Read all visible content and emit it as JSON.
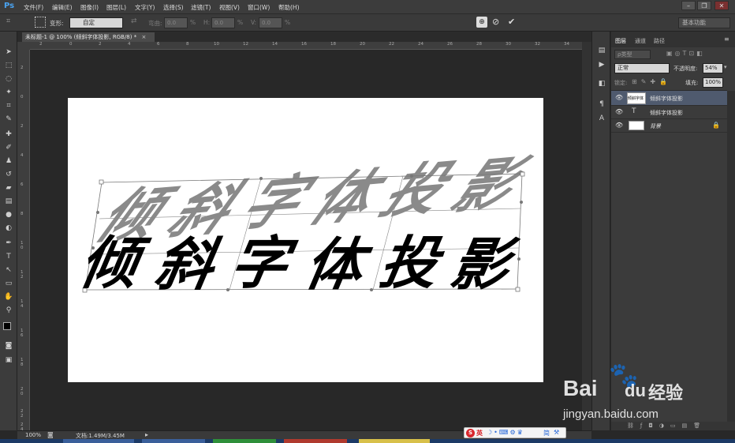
{
  "app": {
    "logo": "Ps"
  },
  "menu": [
    "文件(F)",
    "编辑(E)",
    "图像(I)",
    "图层(L)",
    "文字(Y)",
    "选择(S)",
    "滤镜(T)",
    "视图(V)",
    "窗口(W)",
    "帮助(H)"
  ],
  "options": {
    "warp_label": "变形:",
    "warp_value": "自定",
    "bend_label": "弯曲:",
    "bend_value": "0.0",
    "h_label": "H:",
    "h_value": "0.0",
    "v_label": "V:",
    "v_value": "0.0",
    "percent": "%",
    "workspace": "基本功能"
  },
  "document": {
    "tab_title": "未标题-1 @ 100% (倾斜字体投影, RGB/8) *",
    "text_chars": [
      "倾",
      "斜",
      "字",
      "体",
      "投",
      "影"
    ]
  },
  "ruler": {
    "top": [
      "2",
      "0",
      "2",
      "4",
      "6",
      "8",
      "10",
      "12",
      "14",
      "16",
      "18",
      "20",
      "22",
      "24",
      "26",
      "28",
      "30",
      "32",
      "34"
    ],
    "left": [
      "2",
      "0",
      "2",
      "4",
      "6",
      "8",
      "1\n0",
      "1\n2",
      "1\n4",
      "1\n6",
      "1\n8",
      "2\n0",
      "2\n2",
      "2\n4"
    ]
  },
  "status": {
    "zoom": "100%",
    "doc_info": "文档:1.49M/3.45M"
  },
  "layers_panel": {
    "tabs": [
      "图层",
      "通道",
      "路径"
    ],
    "filter_label": "ρ类型",
    "blend_mode": "正常",
    "opacity_label": "不透明度:",
    "opacity_value": "54%",
    "lock_label": "锁定:",
    "fill_label": "填充:",
    "fill_value": "100%",
    "layers": [
      {
        "name": "倾斜字体投影",
        "selected": true
      },
      {
        "name": "倾斜字体投影",
        "selected": false
      },
      {
        "name": "背景",
        "selected": false
      }
    ]
  },
  "ime": {
    "label": "英",
    "extra": "简"
  },
  "watermark": {
    "brand": "Bai",
    "brand2": "百",
    "brand3": "du",
    "product": "经验",
    "url": "jingyan.baidu.com"
  },
  "colors": {
    "accent": "#4aa3f0",
    "selected_layer": "#4f5a6e",
    "ime_red": "#d9262c"
  }
}
